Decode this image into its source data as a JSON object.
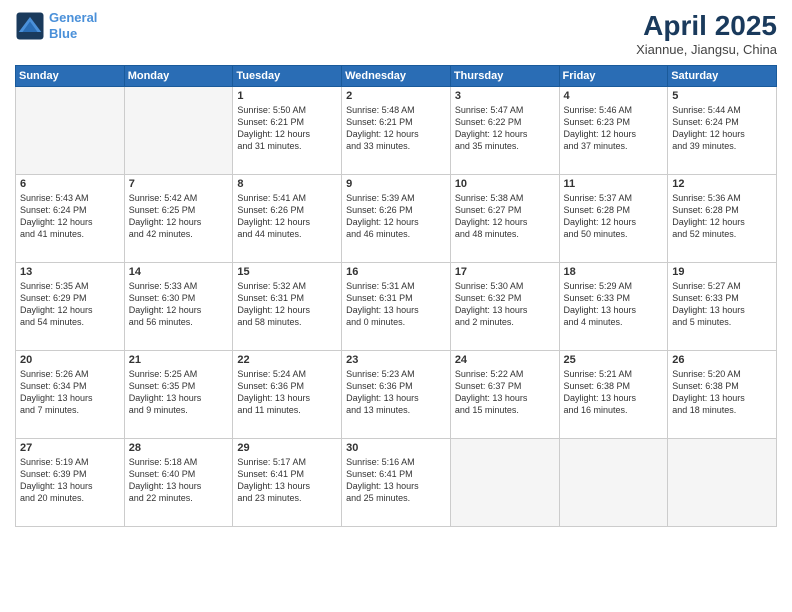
{
  "logo": {
    "line1": "General",
    "line2": "Blue"
  },
  "title": "April 2025",
  "subtitle": "Xiannue, Jiangsu, China",
  "weekdays": [
    "Sunday",
    "Monday",
    "Tuesday",
    "Wednesday",
    "Thursday",
    "Friday",
    "Saturday"
  ],
  "weeks": [
    [
      {
        "day": "",
        "detail": ""
      },
      {
        "day": "",
        "detail": ""
      },
      {
        "day": "1",
        "detail": "Sunrise: 5:50 AM\nSunset: 6:21 PM\nDaylight: 12 hours\nand 31 minutes."
      },
      {
        "day": "2",
        "detail": "Sunrise: 5:48 AM\nSunset: 6:21 PM\nDaylight: 12 hours\nand 33 minutes."
      },
      {
        "day": "3",
        "detail": "Sunrise: 5:47 AM\nSunset: 6:22 PM\nDaylight: 12 hours\nand 35 minutes."
      },
      {
        "day": "4",
        "detail": "Sunrise: 5:46 AM\nSunset: 6:23 PM\nDaylight: 12 hours\nand 37 minutes."
      },
      {
        "day": "5",
        "detail": "Sunrise: 5:44 AM\nSunset: 6:24 PM\nDaylight: 12 hours\nand 39 minutes."
      }
    ],
    [
      {
        "day": "6",
        "detail": "Sunrise: 5:43 AM\nSunset: 6:24 PM\nDaylight: 12 hours\nand 41 minutes."
      },
      {
        "day": "7",
        "detail": "Sunrise: 5:42 AM\nSunset: 6:25 PM\nDaylight: 12 hours\nand 42 minutes."
      },
      {
        "day": "8",
        "detail": "Sunrise: 5:41 AM\nSunset: 6:26 PM\nDaylight: 12 hours\nand 44 minutes."
      },
      {
        "day": "9",
        "detail": "Sunrise: 5:39 AM\nSunset: 6:26 PM\nDaylight: 12 hours\nand 46 minutes."
      },
      {
        "day": "10",
        "detail": "Sunrise: 5:38 AM\nSunset: 6:27 PM\nDaylight: 12 hours\nand 48 minutes."
      },
      {
        "day": "11",
        "detail": "Sunrise: 5:37 AM\nSunset: 6:28 PM\nDaylight: 12 hours\nand 50 minutes."
      },
      {
        "day": "12",
        "detail": "Sunrise: 5:36 AM\nSunset: 6:28 PM\nDaylight: 12 hours\nand 52 minutes."
      }
    ],
    [
      {
        "day": "13",
        "detail": "Sunrise: 5:35 AM\nSunset: 6:29 PM\nDaylight: 12 hours\nand 54 minutes."
      },
      {
        "day": "14",
        "detail": "Sunrise: 5:33 AM\nSunset: 6:30 PM\nDaylight: 12 hours\nand 56 minutes."
      },
      {
        "day": "15",
        "detail": "Sunrise: 5:32 AM\nSunset: 6:31 PM\nDaylight: 12 hours\nand 58 minutes."
      },
      {
        "day": "16",
        "detail": "Sunrise: 5:31 AM\nSunset: 6:31 PM\nDaylight: 13 hours\nand 0 minutes."
      },
      {
        "day": "17",
        "detail": "Sunrise: 5:30 AM\nSunset: 6:32 PM\nDaylight: 13 hours\nand 2 minutes."
      },
      {
        "day": "18",
        "detail": "Sunrise: 5:29 AM\nSunset: 6:33 PM\nDaylight: 13 hours\nand 4 minutes."
      },
      {
        "day": "19",
        "detail": "Sunrise: 5:27 AM\nSunset: 6:33 PM\nDaylight: 13 hours\nand 5 minutes."
      }
    ],
    [
      {
        "day": "20",
        "detail": "Sunrise: 5:26 AM\nSunset: 6:34 PM\nDaylight: 13 hours\nand 7 minutes."
      },
      {
        "day": "21",
        "detail": "Sunrise: 5:25 AM\nSunset: 6:35 PM\nDaylight: 13 hours\nand 9 minutes."
      },
      {
        "day": "22",
        "detail": "Sunrise: 5:24 AM\nSunset: 6:36 PM\nDaylight: 13 hours\nand 11 minutes."
      },
      {
        "day": "23",
        "detail": "Sunrise: 5:23 AM\nSunset: 6:36 PM\nDaylight: 13 hours\nand 13 minutes."
      },
      {
        "day": "24",
        "detail": "Sunrise: 5:22 AM\nSunset: 6:37 PM\nDaylight: 13 hours\nand 15 minutes."
      },
      {
        "day": "25",
        "detail": "Sunrise: 5:21 AM\nSunset: 6:38 PM\nDaylight: 13 hours\nand 16 minutes."
      },
      {
        "day": "26",
        "detail": "Sunrise: 5:20 AM\nSunset: 6:38 PM\nDaylight: 13 hours\nand 18 minutes."
      }
    ],
    [
      {
        "day": "27",
        "detail": "Sunrise: 5:19 AM\nSunset: 6:39 PM\nDaylight: 13 hours\nand 20 minutes."
      },
      {
        "day": "28",
        "detail": "Sunrise: 5:18 AM\nSunset: 6:40 PM\nDaylight: 13 hours\nand 22 minutes."
      },
      {
        "day": "29",
        "detail": "Sunrise: 5:17 AM\nSunset: 6:41 PM\nDaylight: 13 hours\nand 23 minutes."
      },
      {
        "day": "30",
        "detail": "Sunrise: 5:16 AM\nSunset: 6:41 PM\nDaylight: 13 hours\nand 25 minutes."
      },
      {
        "day": "",
        "detail": ""
      },
      {
        "day": "",
        "detail": ""
      },
      {
        "day": "",
        "detail": ""
      }
    ]
  ]
}
